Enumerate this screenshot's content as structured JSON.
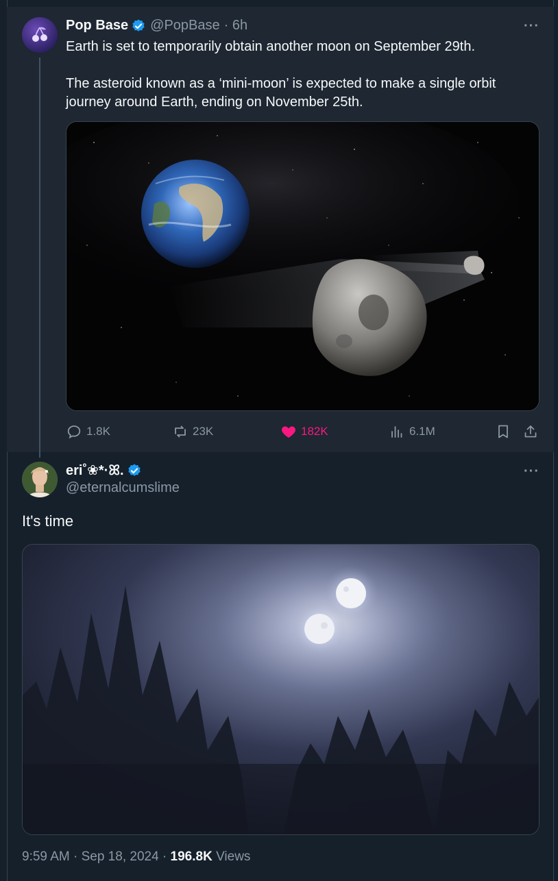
{
  "parent_tweet": {
    "display_name": "Pop Base",
    "handle": "@PopBase",
    "time": "· 6h",
    "text_paragraphs": [
      "Earth is set to temporarily obtain another moon on September 29th.",
      "The asteroid known as a ‘mini-moon’ is expected to make a single orbit journey around Earth, ending on November 25th."
    ],
    "stats": {
      "replies": "1.8K",
      "reposts": "23K",
      "likes": "182K",
      "views": "6.1M"
    },
    "media_icon": "earth-asteroid-image"
  },
  "reply_tweet": {
    "display_name": "eri˚❀*·ꕤ.",
    "handle": "@eternalcumslime",
    "text": "It's time",
    "media_icon": "two-moons-night-sky-image",
    "timestamp": "9:59 AM · Sep 18, 2024 ·",
    "views_count": "196.8K",
    "views_label": "Views"
  },
  "colors": {
    "background": "#15202b",
    "card": "#1e2732",
    "text": "#f7f9f9",
    "muted": "#8b98a5",
    "like": "#f91880",
    "verified": "#1d9bf0"
  }
}
